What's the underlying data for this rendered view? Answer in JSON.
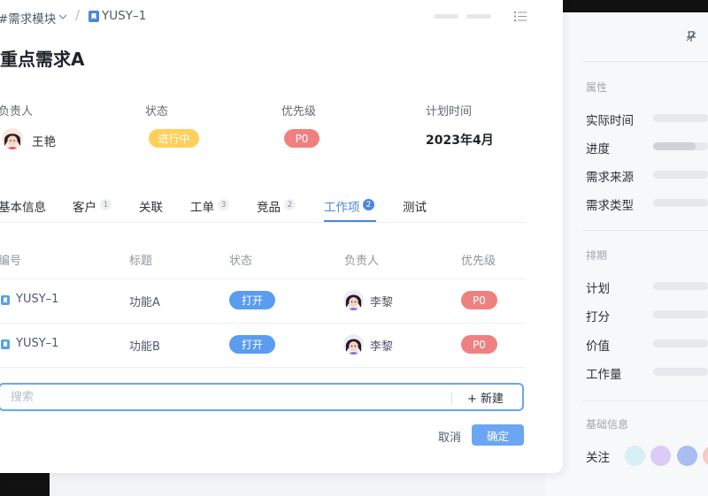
{
  "breadcrumb": {
    "module": "#需求模块",
    "item_id": "YUSY–1"
  },
  "title": "重点需求A",
  "meta": {
    "owner_label": "负责人",
    "owner_name": "王艳",
    "status_label": "状态",
    "status_value": "进行中",
    "priority_label": "优先级",
    "priority_value": "P0",
    "plan_label": "计划时间",
    "plan_value": "2023年4月"
  },
  "tabs": [
    {
      "label": "基本信息"
    },
    {
      "label": "客户",
      "count": "1"
    },
    {
      "label": "关联"
    },
    {
      "label": "工单",
      "count": "3"
    },
    {
      "label": "竞品",
      "count": "2"
    },
    {
      "label": "工作项",
      "count": "2"
    },
    {
      "label": "测试"
    }
  ],
  "table": {
    "headers": [
      "编号",
      "标题",
      "状态",
      "负责人",
      "优先级"
    ],
    "rows": [
      {
        "id": "YUSY–1",
        "title": "功能A",
        "status": "打开",
        "owner": "李黎",
        "priority": "P0"
      },
      {
        "id": "YUSY–1",
        "title": "功能B",
        "status": "打开",
        "owner": "李黎",
        "priority": "P0"
      }
    ]
  },
  "search": {
    "placeholder": "搜索",
    "new_label": "+ 新建"
  },
  "footer": {
    "cancel": "取消",
    "confirm": "确定"
  },
  "side_panel": {
    "section_attributes": "属性",
    "attributes": [
      "实际时间",
      "进度",
      "需求来源",
      "需求类型"
    ],
    "section_schedule": "排期",
    "schedule": [
      "计划",
      "打分",
      "价值",
      "工作量"
    ],
    "section_basic": "基础信息",
    "follow_label": "关注",
    "follower_colors": [
      "#d6eff5",
      "#dccbf4",
      "#a9bdf3",
      "#f7c9c9"
    ]
  },
  "colors": {
    "accent": "#4a87de",
    "status_in_progress": "#ffcf5c",
    "priority": "#f08080",
    "open": "#5a9cf0"
  },
  "icons": [
    "chevron-down-icon",
    "tag-icon",
    "list-icon",
    "pin-icon"
  ]
}
